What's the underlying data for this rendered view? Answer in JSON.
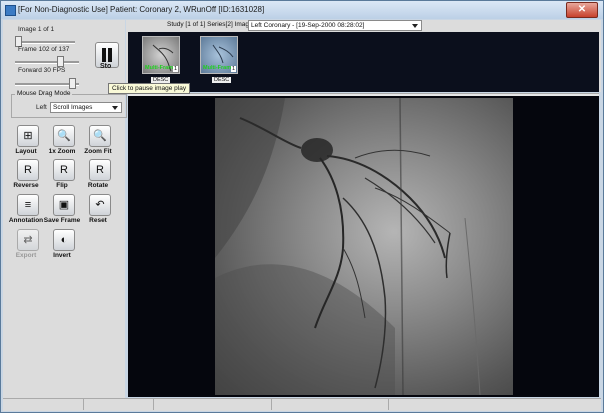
{
  "window": {
    "title": "[For Non-Diagnostic Use] Patient: Coronary 2, WRunOff [ID:1631028]",
    "close_label": "✕"
  },
  "controls": {
    "image_label": "Image 1 of 1",
    "image_position": 0.0,
    "frame_label": "Frame 102 of 137",
    "frame_position": 0.74,
    "fps_label": "Forward 30 FPS",
    "fps_position": 0.95,
    "stop_label": "Sto",
    "tooltip": "Click to pause image play"
  },
  "mouse_drag": {
    "group_label": "Mouse Drag Mode",
    "left_label": "Left",
    "left_value": "Scroll Images"
  },
  "tools": [
    {
      "label": "Layout",
      "icon": "layout-grid-icon",
      "glyph": "⊞"
    },
    {
      "label": "1x Zoom",
      "icon": "zoom-icon",
      "glyph": "🔍"
    },
    {
      "label": "Zoom Fit",
      "icon": "zoom-fit-icon",
      "glyph": "🔍"
    },
    {
      "label": "Reverse",
      "icon": "reverse-icon",
      "glyph": "R"
    },
    {
      "label": "Flip",
      "icon": "flip-icon",
      "glyph": "R"
    },
    {
      "label": "Rotate",
      "icon": "rotate-icon",
      "glyph": "R"
    },
    {
      "label": "Annotation",
      "icon": "annotation-icon",
      "glyph": "≡"
    },
    {
      "label": "Save Frame",
      "icon": "save-frame-icon",
      "glyph": "▣"
    },
    {
      "label": "Reset",
      "icon": "reset-icon",
      "glyph": "↶"
    },
    {
      "label": "Export",
      "icon": "export-icon",
      "glyph": "⇄",
      "disabled": true
    },
    {
      "label": "Invert",
      "icon": "invert-icon",
      "glyph": "◐"
    }
  ],
  "study": {
    "info": "Study [1 of 1] Series[2] Images[2]",
    "selected": "Left Coronary - [19-Sep-2000 08:28:02]"
  },
  "thumbnails": [
    {
      "badge": "Multi-Frame",
      "count": "1",
      "caption": "DESC"
    },
    {
      "badge": "Multi-Frame",
      "count": "1",
      "caption": "DESC"
    }
  ],
  "colors": {
    "accent_green": "#1fd11f",
    "viewer_bg": "#05060d"
  }
}
